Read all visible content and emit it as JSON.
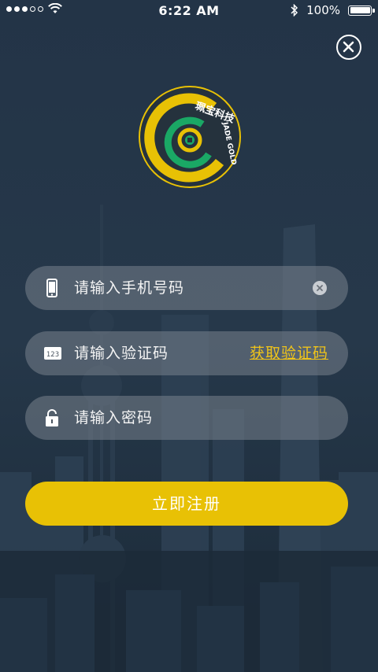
{
  "status_bar": {
    "time": "6:22 AM",
    "battery": "100%",
    "battery_level": 1.0,
    "signal_bars_filled": 3,
    "signal_bars_total": 5
  },
  "logo": {
    "brand_cn": "珮宝科技",
    "brand_en": "JADE GOLD"
  },
  "form": {
    "phone_placeholder": "请输入手机号码",
    "code_placeholder": "请输入验证码",
    "code_icon_text": "123",
    "get_code_label": "获取验证码",
    "password_placeholder": "请输入密码",
    "submit_label": "立即注册"
  },
  "colors": {
    "accent_yellow": "#e8c105",
    "logo_green": "#1aa865",
    "background": "#1f2e3f"
  },
  "icons": [
    "close-icon",
    "phone-icon",
    "clear-icon",
    "code-icon",
    "lock-icon",
    "wifi-icon",
    "bluetooth-icon",
    "battery-icon"
  ]
}
